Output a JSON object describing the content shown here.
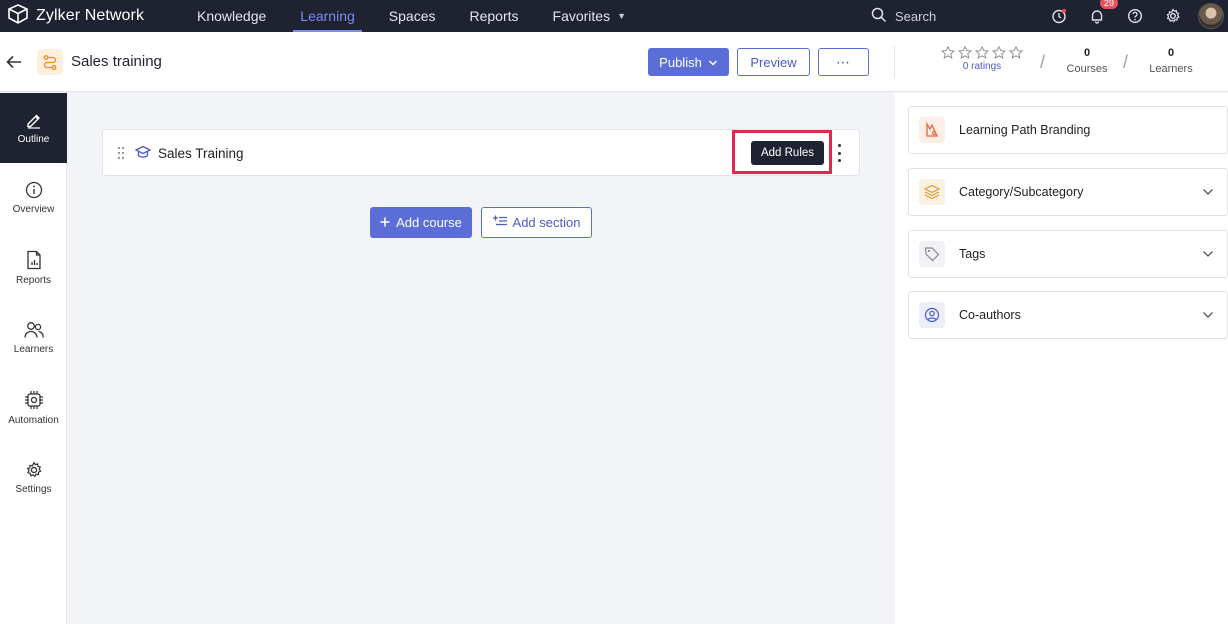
{
  "app": {
    "brand": "Zylker Network"
  },
  "nav": {
    "links": [
      {
        "label": "Knowledge"
      },
      {
        "label": "Learning",
        "active": true
      },
      {
        "label": "Spaces"
      },
      {
        "label": "Reports"
      },
      {
        "label": "Favorites"
      }
    ],
    "search_label": "Search",
    "notifications_count": "29",
    "icons": [
      "timer-icon",
      "bell-icon",
      "help-icon",
      "gear-icon",
      "avatar"
    ]
  },
  "header": {
    "title": "Sales training",
    "publish_label": "Publish",
    "preview_label": "Preview",
    "more_label": "⋯",
    "ratings_link": "0 ratings",
    "stats": [
      {
        "num": "0",
        "label": "Courses"
      },
      {
        "num": "0",
        "label": "Learners"
      }
    ]
  },
  "sidebar": {
    "items": [
      {
        "label": "Outline",
        "icon": "pencil-icon",
        "active": true
      },
      {
        "label": "Overview",
        "icon": "info-icon"
      },
      {
        "label": "Reports",
        "icon": "report-icon"
      },
      {
        "label": "Learners",
        "icon": "users-icon"
      },
      {
        "label": "Automation",
        "icon": "chip-icon"
      },
      {
        "label": "Settings",
        "icon": "gear-icon"
      }
    ]
  },
  "main": {
    "section_title": "Sales Training",
    "add_rules_label": "Add Rules",
    "add_course_label": "Add course",
    "add_section_label": "Add section"
  },
  "right_panel": {
    "items": [
      {
        "label": "Learning Path Branding",
        "icon": "branding-icon"
      },
      {
        "label": "Category/Subcategory",
        "icon": "layers-icon"
      },
      {
        "label": "Tags",
        "icon": "tag-icon"
      },
      {
        "label": "Co-authors",
        "icon": "user-circle-icon"
      }
    ]
  },
  "colors": {
    "nav_bg": "#1f2230",
    "accent": "#5b6ed8",
    "highlight": "#e0294f",
    "lp_icon": "#f08a2c"
  }
}
